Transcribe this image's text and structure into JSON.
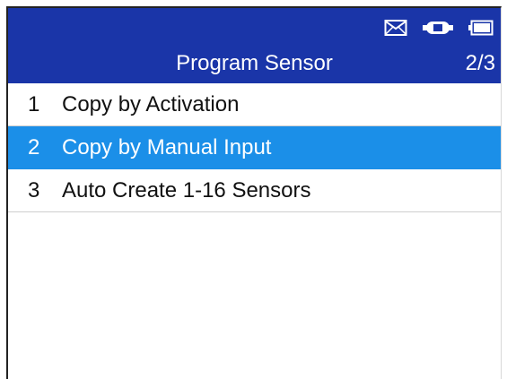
{
  "header": {
    "title": "Program Sensor",
    "page_indicator": "2/3",
    "status_icons": [
      "mail-icon",
      "vehicle-connection-icon",
      "battery-icon"
    ]
  },
  "menu": {
    "items": [
      {
        "number": "1",
        "label": "Copy by Activation",
        "selected": false
      },
      {
        "number": "2",
        "label": "Copy by Manual Input",
        "selected": true
      },
      {
        "number": "3",
        "label": "Auto Create 1-16 Sensors",
        "selected": false
      }
    ]
  },
  "colors": {
    "header_bg": "#1a35a8",
    "selected_bg": "#1b8fe8",
    "text": "#111111"
  }
}
